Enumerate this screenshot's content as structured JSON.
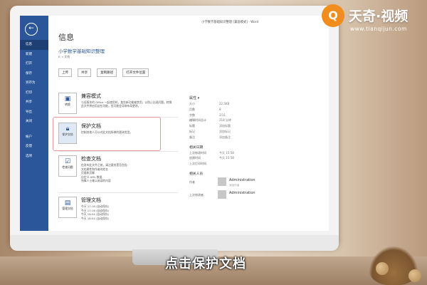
{
  "window": {
    "title": "小学数学基础知识整理 [兼容模式] - Word"
  },
  "sidebar": {
    "items": [
      {
        "label": "信息"
      },
      {
        "label": "新建"
      },
      {
        "label": "打开"
      },
      {
        "label": "保存"
      },
      {
        "label": "另存为"
      },
      {
        "label": "打印"
      },
      {
        "label": "共享"
      },
      {
        "label": "导出"
      },
      {
        "label": "关闭"
      },
      {
        "label": "帐户"
      },
      {
        "label": "反馈"
      },
      {
        "label": "选项"
      }
    ]
  },
  "header": {
    "page_title": "信息",
    "doc_name": "小学数学基础知识整理",
    "doc_path": "E: » 文档",
    "buttons": [
      "上传",
      "共享",
      "复制路径",
      "打开文件位置"
    ]
  },
  "sections": {
    "compat": {
      "title": "兼容模式",
      "desc": "与旧版本的 Office 一起使用时，某些新功能被禁用，以防止出现问题。转换此文件将启用这些功能，但可能会导致布局更改。",
      "icon_label": "转换"
    },
    "protect": {
      "title": "保护文档",
      "desc": "控制其他人可以对此文档所做的更改类型。",
      "icon_label": "保护文档"
    },
    "inspect": {
      "title": "检查文档",
      "desc": "在发布此文件之前，请注意其是否包含:",
      "items": [
        "文档属性和作者的姓名",
        "页眉和页脚",
        "自定义 XML 数据",
        "残障人士难以阅读的内容"
      ],
      "icon_label": "检查问题"
    },
    "manage": {
      "title": "管理文档",
      "items": [
        "今天 17:18 (自动保存)",
        "今天 17:16 (自动保存)",
        "今天 16:54 (自动保存)",
        "今天 16:54 (自动保存)"
      ],
      "icon_label": "管理文档"
    }
  },
  "properties": {
    "heading": "属性 ▾",
    "rows": [
      {
        "k": "大小",
        "v": "22.5KB"
      },
      {
        "k": "页数",
        "v": "8"
      },
      {
        "k": "字数",
        "v": "2/11"
      },
      {
        "k": "编辑时间总计",
        "v": "218 分钟"
      },
      {
        "k": "标题",
        "v": "添加标题"
      },
      {
        "k": "标记",
        "v": "添加标记"
      },
      {
        "k": "备注",
        "v": "添加备注"
      }
    ],
    "dates_heading": "相关日期",
    "dates": [
      {
        "k": "上次修改时间",
        "v": "今天 15:58"
      },
      {
        "k": "创建时间",
        "v": "今天 15:58"
      },
      {
        "k": "上次打印时间",
        "v": ""
      }
    ],
    "people_heading": "相关人员",
    "author_label": "作者",
    "author_name": "Administration",
    "author_sub": "添加作者",
    "modifier_label": "上次修改者",
    "modifier_name": "Administration"
  },
  "overlay": {
    "logo_mark": "Q",
    "logo_name": "天奇·视频",
    "logo_url": "www.tianqijun.com",
    "caption": "点击保护文档"
  }
}
